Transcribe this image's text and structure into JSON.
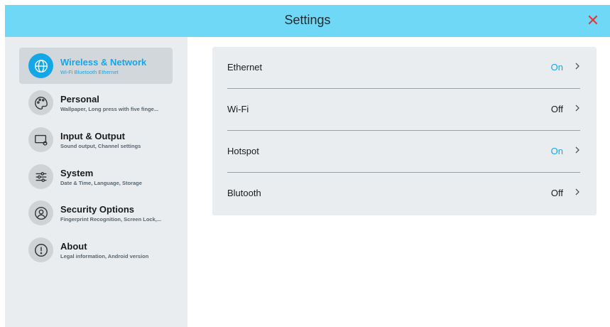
{
  "header": {
    "title": "Settings",
    "close_icon": "close-icon"
  },
  "sidebar": {
    "items": [
      {
        "title": "Wireless & Network",
        "subtitle": "Wi-Fi Bluetooth Ethernet",
        "icon": "globe-icon",
        "active": true
      },
      {
        "title": "Personal",
        "subtitle": "Wallpaper, Long press with five finge...",
        "icon": "palette-icon",
        "active": false
      },
      {
        "title": "Input & Output",
        "subtitle": "Sound output, Channel settings",
        "icon": "display-settings-icon",
        "active": false
      },
      {
        "title": "System",
        "subtitle": "Date & Time, Language, Storage",
        "icon": "sliders-icon",
        "active": false
      },
      {
        "title": "Security Options",
        "subtitle": "Fingerprint Recognition, Screen Lock,...",
        "icon": "user-lock-icon",
        "active": false
      },
      {
        "title": "About",
        "subtitle": "Legal information, Android version",
        "icon": "info-icon",
        "active": false
      }
    ]
  },
  "network": {
    "rows": [
      {
        "label": "Ethernet",
        "value": "On",
        "state": "on"
      },
      {
        "label": "Wi-Fi",
        "value": "Off",
        "state": "off"
      },
      {
        "label": "Hotspot",
        "value": "On",
        "state": "on"
      },
      {
        "label": "Blutooth",
        "value": "Off",
        "state": "off"
      }
    ]
  },
  "colors": {
    "accent": "#14a7e8",
    "header": "#6fd8f7",
    "close": "#e03a3a",
    "panel": "#e9edf0"
  }
}
